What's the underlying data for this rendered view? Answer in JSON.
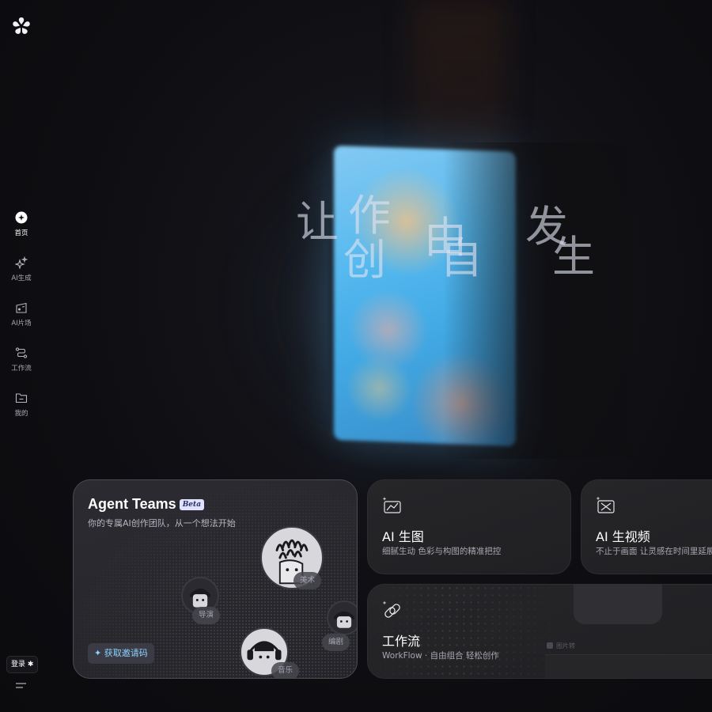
{
  "sidebar": {
    "items": [
      {
        "label": "首页",
        "icon": "home-icon",
        "active": true
      },
      {
        "label": "AI生成",
        "icon": "sparkle-icon"
      },
      {
        "label": "AI片场",
        "icon": "film-folder-icon"
      },
      {
        "label": "工作流",
        "icon": "workflow-icon"
      },
      {
        "label": "我的",
        "icon": "folder-icon"
      }
    ],
    "login_label": "登录 ✱",
    "menu_icon": "hamburger-icon"
  },
  "hero": {
    "slogan_chars": [
      "让",
      "作",
      "创",
      "由",
      "自",
      "发",
      "生"
    ]
  },
  "agent_card": {
    "title": "Agent Teams",
    "badge": "Beta",
    "subtitle": "你的专属AI创作团队，从一个想法开始",
    "invite_label": "获取邀请码",
    "roles": [
      "美术",
      "导演",
      "编剧",
      "音乐"
    ]
  },
  "image_card": {
    "title": "AI 生图",
    "subtitle": "细腻生动 色彩与构图的精准把控",
    "icon": "image-chart-icon"
  },
  "video_card": {
    "title": "AI 生视频",
    "subtitle": "不止于画面 让灵感在时间里延展",
    "icon": "video-bowtie-icon"
  },
  "workflow_card": {
    "title": "工作流",
    "subtitle": "WorkFlow · 自由组合 轻松创作",
    "icon": "link-icon",
    "node_label": "图片转"
  },
  "colors": {
    "background": "#0f0f12",
    "card": "#242429",
    "accent": "#8fd0ff",
    "badge": "#dfe2ff"
  }
}
